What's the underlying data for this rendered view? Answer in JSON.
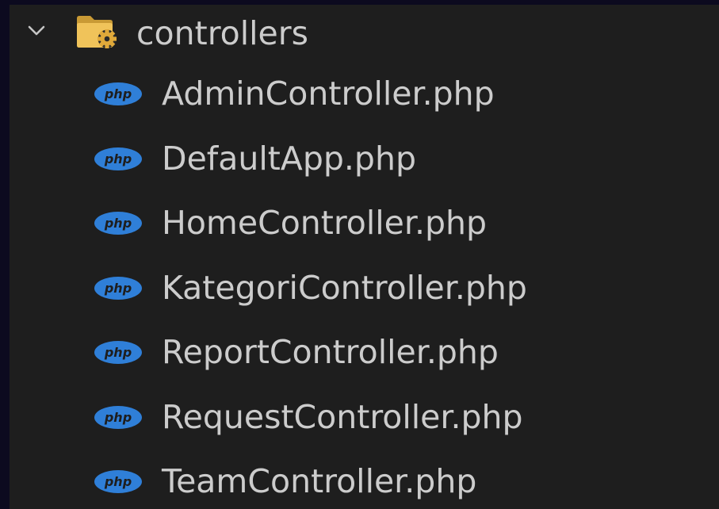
{
  "explorer": {
    "folder": {
      "name": "controllers",
      "expanded": true,
      "chevron_icon": "chevron-down-icon",
      "folder_icon": "folder-controller-icon"
    },
    "files": [
      {
        "name": "AdminController.php",
        "icon": "php-icon"
      },
      {
        "name": "DefaultApp.php",
        "icon": "php-icon"
      },
      {
        "name": "HomeController.php",
        "icon": "php-icon"
      },
      {
        "name": "KategoriController.php",
        "icon": "php-icon"
      },
      {
        "name": "ReportController.php",
        "icon": "php-icon"
      },
      {
        "name": "RequestController.php",
        "icon": "php-icon"
      },
      {
        "name": "TeamController.php",
        "icon": "php-icon"
      }
    ],
    "php_icon_text": "php"
  },
  "colors": {
    "background": "#1e1e1e",
    "outer_background": "#0c0a1f",
    "text": "#cccccc",
    "php_icon": "#2f7fd8",
    "folder": "#e8b84a",
    "folder_gear": "#d9a23a"
  }
}
